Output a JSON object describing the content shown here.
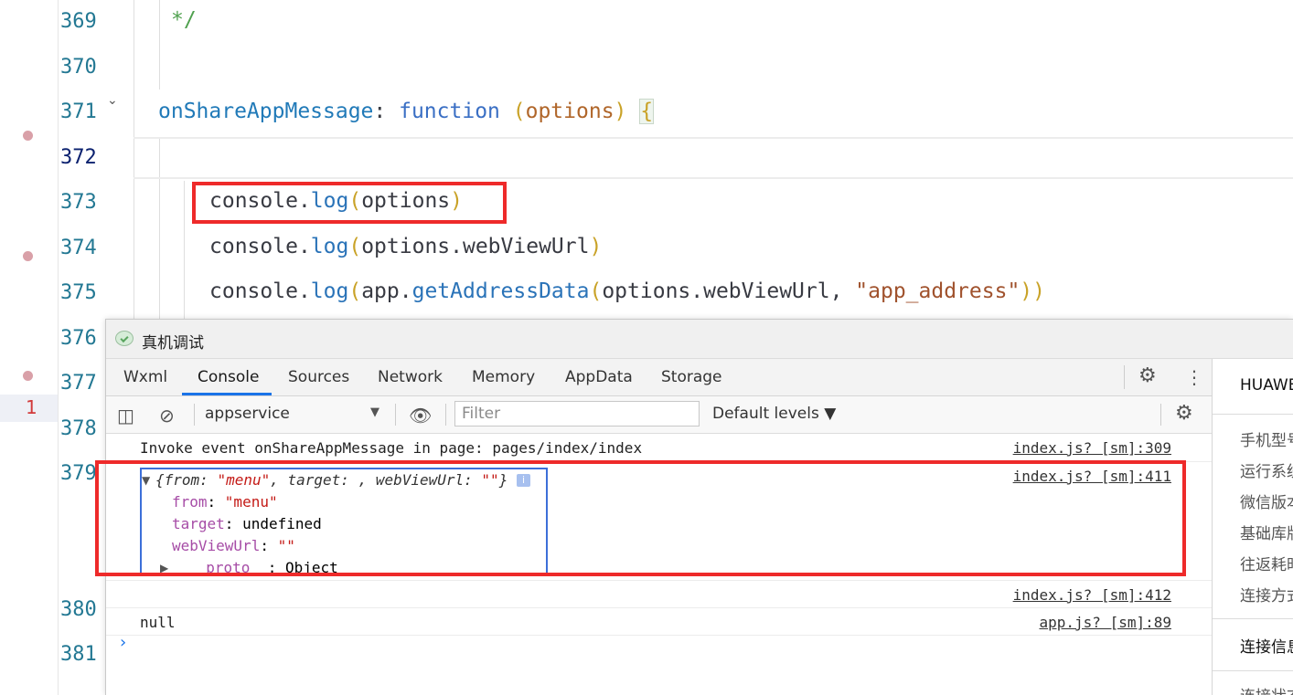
{
  "editor": {
    "line_numbers": [
      "369",
      "370",
      "371",
      "372",
      "373",
      "374",
      "375",
      "376",
      "377",
      "378",
      "379",
      "380",
      "381"
    ],
    "active_line": "372",
    "error_count": "1",
    "lines": {
      "l369": "*/",
      "l371": {
        "prop": "onShareAppMessage",
        "colon": ": ",
        "kw": "function",
        "space": " ",
        "lp": "(",
        "param": "options",
        "rp": ")",
        "brace": "{"
      },
      "l373": {
        "obj": "console",
        "dot": ".",
        "fn": "log",
        "lp": "(",
        "arg": "options",
        "rp": ")"
      },
      "l374": {
        "obj": "console",
        "dot": ".",
        "fn": "log",
        "lp": "(",
        "arg": "options.webViewUrl",
        "rp": ")"
      },
      "l375": {
        "obj": "console",
        "dot": ".",
        "fn": "log",
        "lp": "(",
        "app": "app.",
        "fn2": "getAddressData",
        "lp2": "(",
        "arg": "options.webViewUrl, ",
        "str": "\"app_address\"",
        "rp2": ")",
        "rp": ")"
      }
    }
  },
  "debug": {
    "title": "真机调试",
    "tabs": [
      "Wxml",
      "Console",
      "Sources",
      "Network",
      "Memory",
      "AppData",
      "Storage"
    ],
    "active_tab": "Console",
    "toolbar": {
      "context": "appservice",
      "filter_placeholder": "Filter",
      "levels": "Default levels ▼"
    },
    "messages": [
      {
        "text": "Invoke event onShareAppMessage in page: pages/index/index",
        "source": "index.js? [sm]:309"
      },
      {
        "source": "index.js? [sm]:411"
      },
      {
        "source": "index.js? [sm]:412"
      },
      {
        "text": "null",
        "source": "app.js? [sm]:89"
      }
    ],
    "object": {
      "summary_open": "{",
      "summary_k1": "from",
      "summary_sep": ": ",
      "summary_v1": "\"menu\"",
      "summary_comma1": ", ",
      "summary_k2": "target",
      "summary_mid": ": , ",
      "summary_k3": "webViewUrl",
      "summary_v3": "\"\"",
      "summary_close": "}",
      "info": "i",
      "props": [
        {
          "key": "from",
          "sep": ": ",
          "value": "\"menu\""
        },
        {
          "key": "target",
          "sep": ": ",
          "value": "undefined"
        },
        {
          "key": "webViewUrl",
          "sep": ": ",
          "value": "\"\""
        }
      ],
      "proto_key": "__proto__",
      "proto_value": ": Object"
    },
    "side": {
      "header": "HUAWEI",
      "items": [
        "手机型号",
        "运行系统",
        "微信版本",
        "基础库版",
        "往返耗时",
        "连接方式"
      ],
      "section": "连接信息",
      "section_item": "连接状态"
    }
  }
}
